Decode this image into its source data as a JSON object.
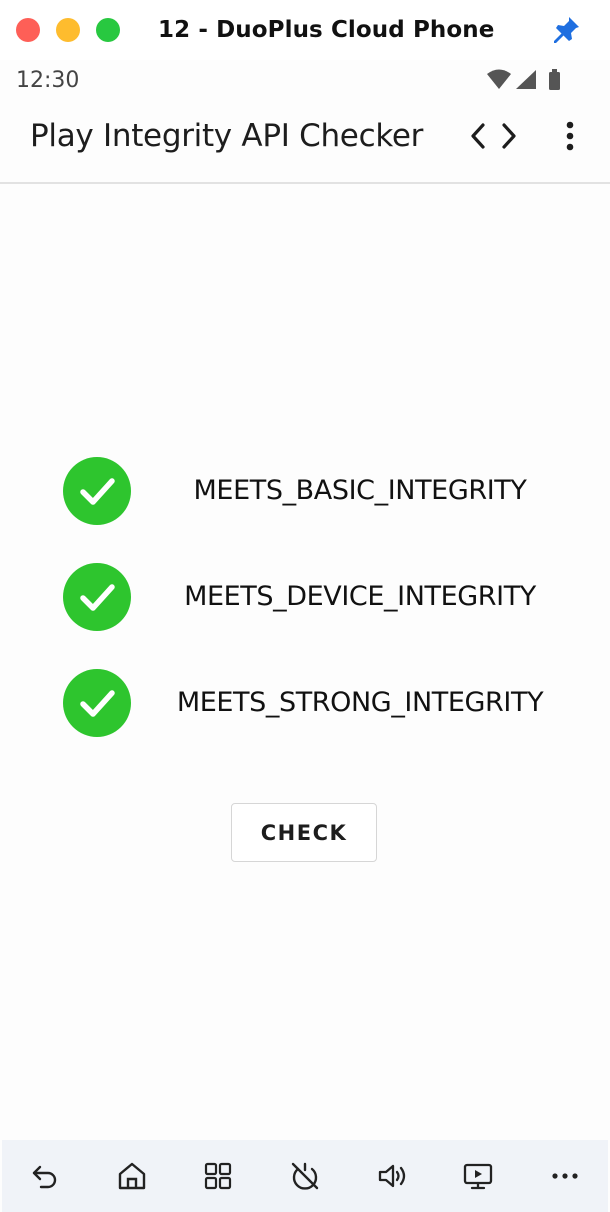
{
  "window": {
    "title": "12 - DuoPlus Cloud Phone",
    "pin_icon": "pin-icon"
  },
  "status_bar": {
    "time": "12:30",
    "icons": [
      "wifi-icon",
      "cell-signal-icon",
      "battery-icon"
    ]
  },
  "app_bar": {
    "title": "Play Integrity API Checker",
    "actions": [
      "code-icon",
      "more-vert-icon"
    ]
  },
  "results": [
    {
      "label": "MEETS_BASIC_INTEGRITY",
      "passed": true,
      "icon": "check-circle-icon"
    },
    {
      "label": "MEETS_DEVICE_INTEGRITY",
      "passed": true,
      "icon": "check-circle-icon"
    },
    {
      "label": "MEETS_STRONG_INTEGRITY",
      "passed": true,
      "icon": "check-circle-icon"
    }
  ],
  "check_button": {
    "label": "CHECK"
  },
  "toolbar": {
    "items": [
      "back-icon",
      "home-icon",
      "apps-grid-icon",
      "timer-off-icon",
      "volume-icon",
      "screen-cast-icon",
      "more-horiz-icon"
    ]
  },
  "colors": {
    "success": "#2ec52e",
    "accent_pin": "#1f6fe0",
    "toolbar_bg": "#f0f3f8"
  }
}
